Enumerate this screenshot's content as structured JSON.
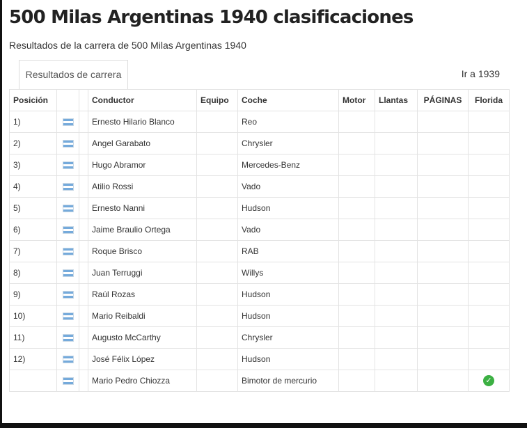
{
  "page": {
    "title": "500 Milas Argentinas 1940 clasificaciones",
    "subtitle": "Resultados de la carrera de 500 Milas Argentinas 1940",
    "tab_label": "Resultados de carrera",
    "prev_link": "Ir a 1939"
  },
  "table": {
    "headers": {
      "position": "Posición",
      "flag": "",
      "blank": "",
      "driver": "Conductor",
      "team": "Equipo",
      "car": "Coche",
      "engine": "Motor",
      "tyres": "Llantas",
      "pages": "PÁGINAS",
      "florida": "Florida"
    },
    "rows": [
      {
        "position": "1)",
        "flag": "flag-argentina-icon",
        "driver": "Ernesto Hilario Blanco",
        "team": "",
        "car": "Reo",
        "engine": "",
        "tyres": "",
        "pages": "",
        "florida": false
      },
      {
        "position": "2)",
        "flag": "flag-argentina-icon",
        "driver": "Angel Garabato",
        "team": "",
        "car": "Chrysler",
        "engine": "",
        "tyres": "",
        "pages": "",
        "florida": false
      },
      {
        "position": "3)",
        "flag": "flag-argentina-icon",
        "driver": "Hugo Abramor",
        "team": "",
        "car": "Mercedes-Benz",
        "engine": "",
        "tyres": "",
        "pages": "",
        "florida": false
      },
      {
        "position": "4)",
        "flag": "flag-argentina-icon",
        "driver": "Atilio Rossi",
        "team": "",
        "car": "Vado",
        "engine": "",
        "tyres": "",
        "pages": "",
        "florida": false
      },
      {
        "position": "5)",
        "flag": "flag-argentina-icon",
        "driver": "Ernesto Nanni",
        "team": "",
        "car": "Hudson",
        "engine": "",
        "tyres": "",
        "pages": "",
        "florida": false
      },
      {
        "position": "6)",
        "flag": "flag-argentina-icon",
        "driver": "Jaime Braulio Ortega",
        "team": "",
        "car": "Vado",
        "engine": "",
        "tyres": "",
        "pages": "",
        "florida": false
      },
      {
        "position": "7)",
        "flag": "flag-argentina-icon",
        "driver": "Roque Brisco",
        "team": "",
        "car": "RAB",
        "engine": "",
        "tyres": "",
        "pages": "",
        "florida": false
      },
      {
        "position": "8)",
        "flag": "flag-argentina-icon",
        "driver": "Juan Terruggi",
        "team": "",
        "car": "Willys",
        "engine": "",
        "tyres": "",
        "pages": "",
        "florida": false
      },
      {
        "position": "9)",
        "flag": "flag-argentina-icon",
        "driver": "Raúl Rozas",
        "team": "",
        "car": "Hudson",
        "engine": "",
        "tyres": "",
        "pages": "",
        "florida": false
      },
      {
        "position": "10)",
        "flag": "flag-argentina-icon",
        "driver": "Mario Reibaldi",
        "team": "",
        "car": "Hudson",
        "engine": "",
        "tyres": "",
        "pages": "",
        "florida": false
      },
      {
        "position": "11)",
        "flag": "flag-argentina-icon",
        "driver": "Augusto McCarthy",
        "team": "",
        "car": "Chrysler",
        "engine": "",
        "tyres": "",
        "pages": "",
        "florida": false
      },
      {
        "position": "12)",
        "flag": "flag-argentina-icon",
        "driver": "José Félix López",
        "team": "",
        "car": "Hudson",
        "engine": "",
        "tyres": "",
        "pages": "",
        "florida": false
      },
      {
        "position": "",
        "flag": "flag-argentina-icon",
        "driver": "Mario Pedro Chiozza",
        "team": "",
        "car": "Bimotor de mercurio",
        "engine": "",
        "tyres": "",
        "pages": "",
        "florida": true
      }
    ]
  },
  "colors": {
    "flag_blue": "#75aadb",
    "check_green": "#3cb043",
    "border": "#e3e3e3"
  }
}
